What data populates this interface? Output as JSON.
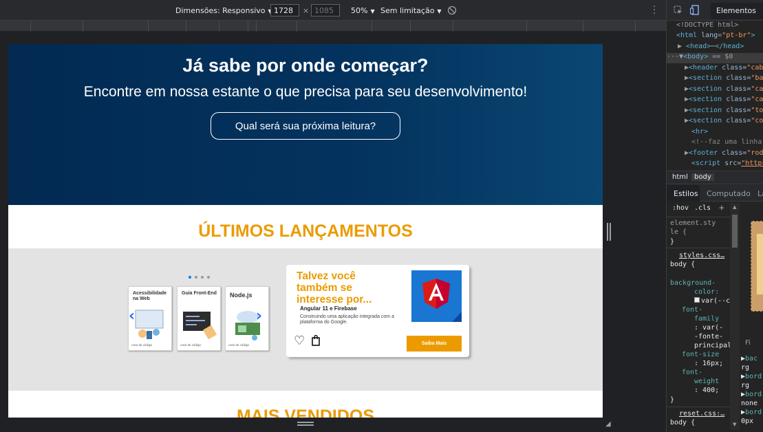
{
  "toolbar": {
    "dimensions_label": "Dimensões: Responsivo",
    "width_value": "1728",
    "times": "×",
    "height_placeholder": "1085",
    "zoom": "50%",
    "throttle": "Sem limitação"
  },
  "page": {
    "hero": {
      "title": "Já sabe por onde começar?",
      "subtitle": "Encontre em nossa estante o que precisa para seu desenvolvimento!",
      "button": "Qual será sua próxima leitura?"
    },
    "launches_title": "ÚLTIMOS LANÇAMENTOS",
    "books": [
      {
        "title": "Acessibilidade na Web"
      },
      {
        "title": "Guia Front-End"
      },
      {
        "title": "Node.js"
      }
    ],
    "book_logo": "casa do código",
    "card": {
      "heading": "Talvez você também se interesse por...",
      "book_title": "Angular 11 e Firebase",
      "book_desc": "Construindo uma aplicação integrada com a plataforma do Google.",
      "buy_button": "Saiba Mais"
    },
    "bestsellers_title": "MAIS VENDIDOS"
  },
  "devtools": {
    "tab_elements": "Elementos",
    "dom": {
      "doctype": "<!DOCTYPE html>",
      "html_tag": "<html ",
      "html_attr": "lang",
      "html_val": "\"pt-br\"",
      "html_close": ">",
      "head": "<head>",
      "head_close": "</head>",
      "ellipsis": "⋯",
      "body_open": "<body>",
      "body_eq": " == $0",
      "header_tag": "<header ",
      "section_tag": "<section ",
      "footer_tag": "<footer ",
      "script_tag": "<script ",
      "class_attr": "class=",
      "src_attr": "src=",
      "header_val": "\"cab",
      "section_vals": [
        "\"ba",
        "\"ca",
        "\"ca",
        "\"to",
        "\"co"
      ],
      "footer_val": "\"rod",
      "script_val": "\"https",
      "hr": "<hr>",
      "comment": "<!--faz uma linha"
    },
    "crumbs": [
      "html",
      "body"
    ],
    "style_tabs": [
      "Estilos",
      "Computado",
      "La"
    ],
    "filter": {
      "hov": ":hov",
      "cls": ".cls",
      "plus": "+"
    },
    "styles": {
      "element_style_1": "element.sty",
      "element_style_2": "le {",
      "close": "}",
      "styles_file": "styles.css…",
      "body_sel": "body {",
      "prop_bg_1": "background-",
      "prop_bg_2": "color:",
      "val_bg": "var(--c",
      "prop_ff_1": "font-",
      "prop_ff_2": "family",
      "val_ff_1": ": var(-",
      "val_ff_2": "-fonte-",
      "val_ff_3": "principal",
      "prop_fs": "font-size",
      "val_fs": ": 16px;",
      "prop_fw_1": "font-",
      "prop_fw_2": "weight",
      "val_fw": ": 400;",
      "reset_file": "reset.css:…",
      "reset_body": "body {"
    },
    "computed": [
      "bac",
      "rg",
      "bord",
      "rg",
      "bord",
      "none",
      "bord",
      "0px"
    ],
    "filter_label": "Fi"
  }
}
